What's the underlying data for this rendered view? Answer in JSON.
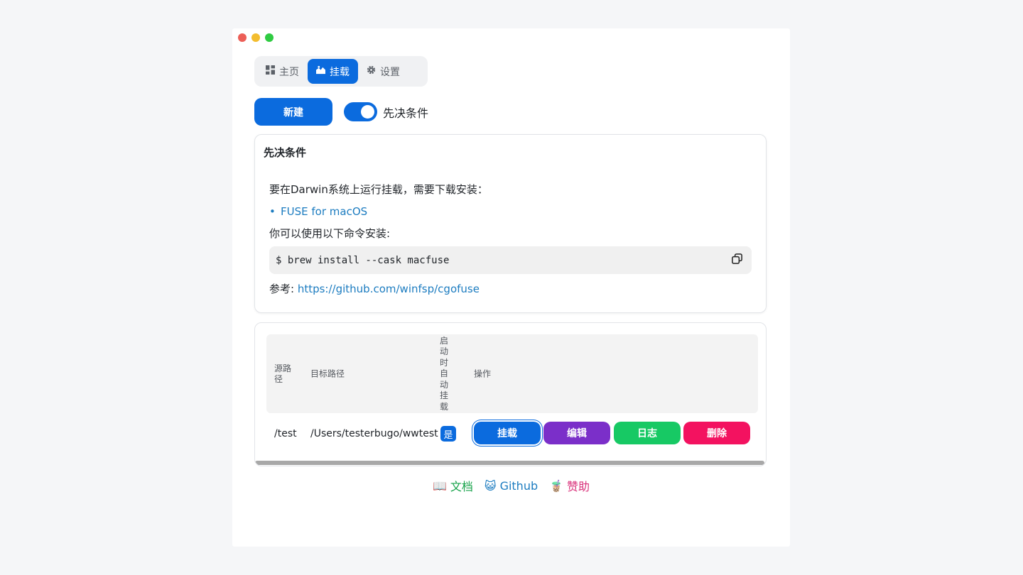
{
  "tabs": [
    {
      "label": "主页",
      "icon": "dashboard-icon"
    },
    {
      "label": "挂载",
      "icon": "mount-icon"
    },
    {
      "label": "设置",
      "icon": "gear-icon"
    }
  ],
  "toolbar": {
    "new_label": "新建",
    "toggle_label": "先决条件",
    "toggle_on": true
  },
  "prereq": {
    "title": "先决条件",
    "intro": "要在Darwin系统上运行挂载，需要下载安装：",
    "link_item": "FUSE for macOS",
    "command_intro": "你可以使用以下命令安装:",
    "command": "$ brew install --cask macfuse",
    "ref_label": "参考: ",
    "ref_link": "https://github.com/winfsp/cgofuse"
  },
  "table": {
    "headers": {
      "src": "源路径",
      "dst": "目标路径",
      "auto": "启动时自动挂载",
      "ops": "操作"
    },
    "rows": [
      {
        "src": "/test",
        "dst": "/Users/testerbugo/wwtest",
        "auto": "是"
      }
    ],
    "actions": {
      "mount": "挂载",
      "edit": "编辑",
      "log": "日志",
      "delete": "删除"
    }
  },
  "footer": {
    "docs": "文档",
    "github": "Github",
    "donate": "赞助",
    "docs_emoji": "📖",
    "github_emoji": "😺",
    "donate_emoji": "🧋"
  },
  "colors": {
    "primary": "#0b6bde",
    "edit": "#7b2fc9",
    "log": "#17c964",
    "delete": "#f31260"
  }
}
